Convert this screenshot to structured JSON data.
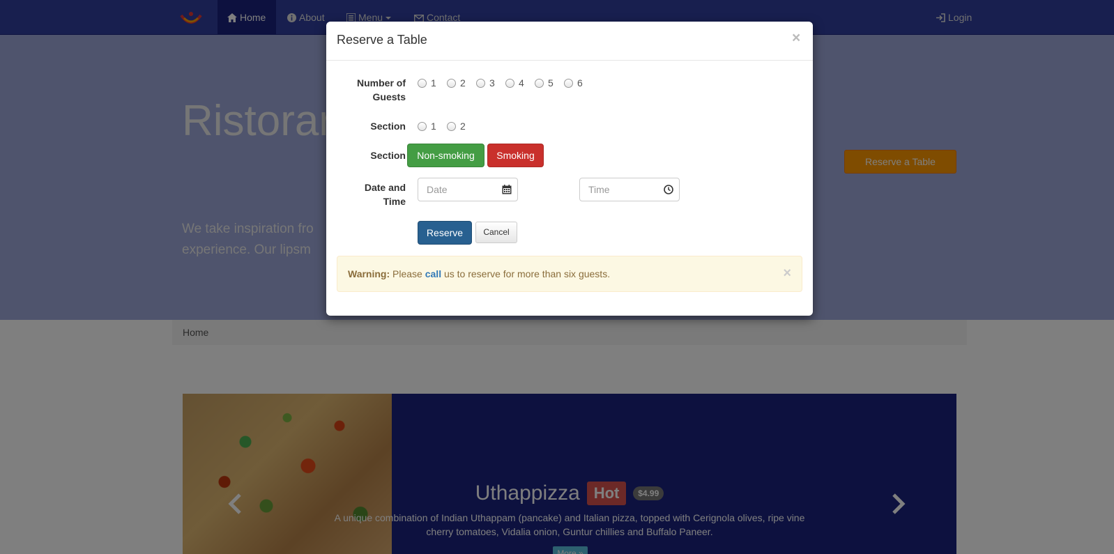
{
  "navbar": {
    "items": [
      {
        "label": "Home",
        "icon": "home-icon"
      },
      {
        "label": "About",
        "icon": "info-icon"
      },
      {
        "label": "Menu",
        "icon": "list-icon"
      },
      {
        "label": "Contact",
        "icon": "envelope-icon"
      }
    ],
    "login": {
      "label": "Login",
      "icon": "login-icon"
    },
    "colors": {
      "background": "#303f9f",
      "active": "#1a237e"
    }
  },
  "hero": {
    "title": "Ristorar",
    "text": "We take inspiration fro",
    "text_line2": "experience. Our lipsm",
    "reserve_button": "Reserve a Table",
    "colors": {
      "background": "#9fa8da",
      "reserve_button": "#ff9800"
    }
  },
  "breadcrumb": {
    "current": "Home"
  },
  "carousel": {
    "dish_name": "Uthappizza",
    "label": "Hot",
    "price": "$4.99",
    "description": "A unique combination of Indian Uthappam (pancake) and Italian pizza, topped with Cerignola olives, ripe vine cherry tomatoes, Vidalia onion, Guntur chillies and Buffalo Paneer.",
    "more_button": "More »",
    "prev_icon": "chevron-left-icon",
    "next_icon": "chevron-right-icon",
    "colors": {
      "background": "#1a237e",
      "label": "#d9534f"
    }
  },
  "modal": {
    "title": "Reserve a Table",
    "close": "×",
    "guests_label": "Number of Guests",
    "guests_label_line1": "Number of",
    "guests_label_line2": "Guests",
    "guest_options": [
      "1",
      "2",
      "3",
      "4",
      "5",
      "6"
    ],
    "section_label": "Section",
    "section_options": [
      "1",
      "2"
    ],
    "section_label2": "Section",
    "nonsmoking_button": "Non-smoking",
    "smoking_button": "Smoking",
    "datetime_label_line1": "Date and",
    "datetime_label_line2": "Time",
    "date_placeholder": "Date",
    "time_placeholder": "Time",
    "reserve_button": "Reserve",
    "cancel_button": "Cancel",
    "alert": {
      "strong": "Warning:",
      "before_link": " Please ",
      "link": "call",
      "after_link": " us to reserve for more than six guests.",
      "close": "×"
    },
    "colors": {
      "nonsmoking": "#449d44",
      "smoking": "#c9302c",
      "reserve": "#286090",
      "alert_bg": "#fcf8e3"
    }
  }
}
